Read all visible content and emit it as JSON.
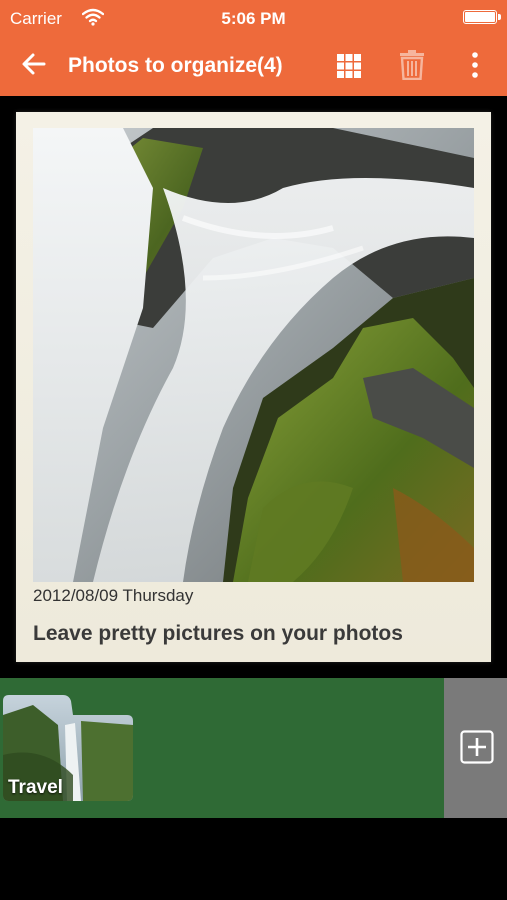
{
  "status_bar": {
    "carrier": "Carrier",
    "time": "5:06 PM"
  },
  "toolbar": {
    "title": "Photos to organize(4)",
    "icons": [
      "back-arrow-icon",
      "grid-icon",
      "trash-icon",
      "more-vertical-icon"
    ],
    "accent_color": "#ee6a3b"
  },
  "photo_card": {
    "date": "2012/08/09 Thursday",
    "caption": "Leave pretty pictures on your photos"
  },
  "albums": [
    {
      "label": "Travel"
    }
  ],
  "colors": {
    "album_strip": "#2f6a35",
    "add_panel": "#7a7a7a"
  }
}
